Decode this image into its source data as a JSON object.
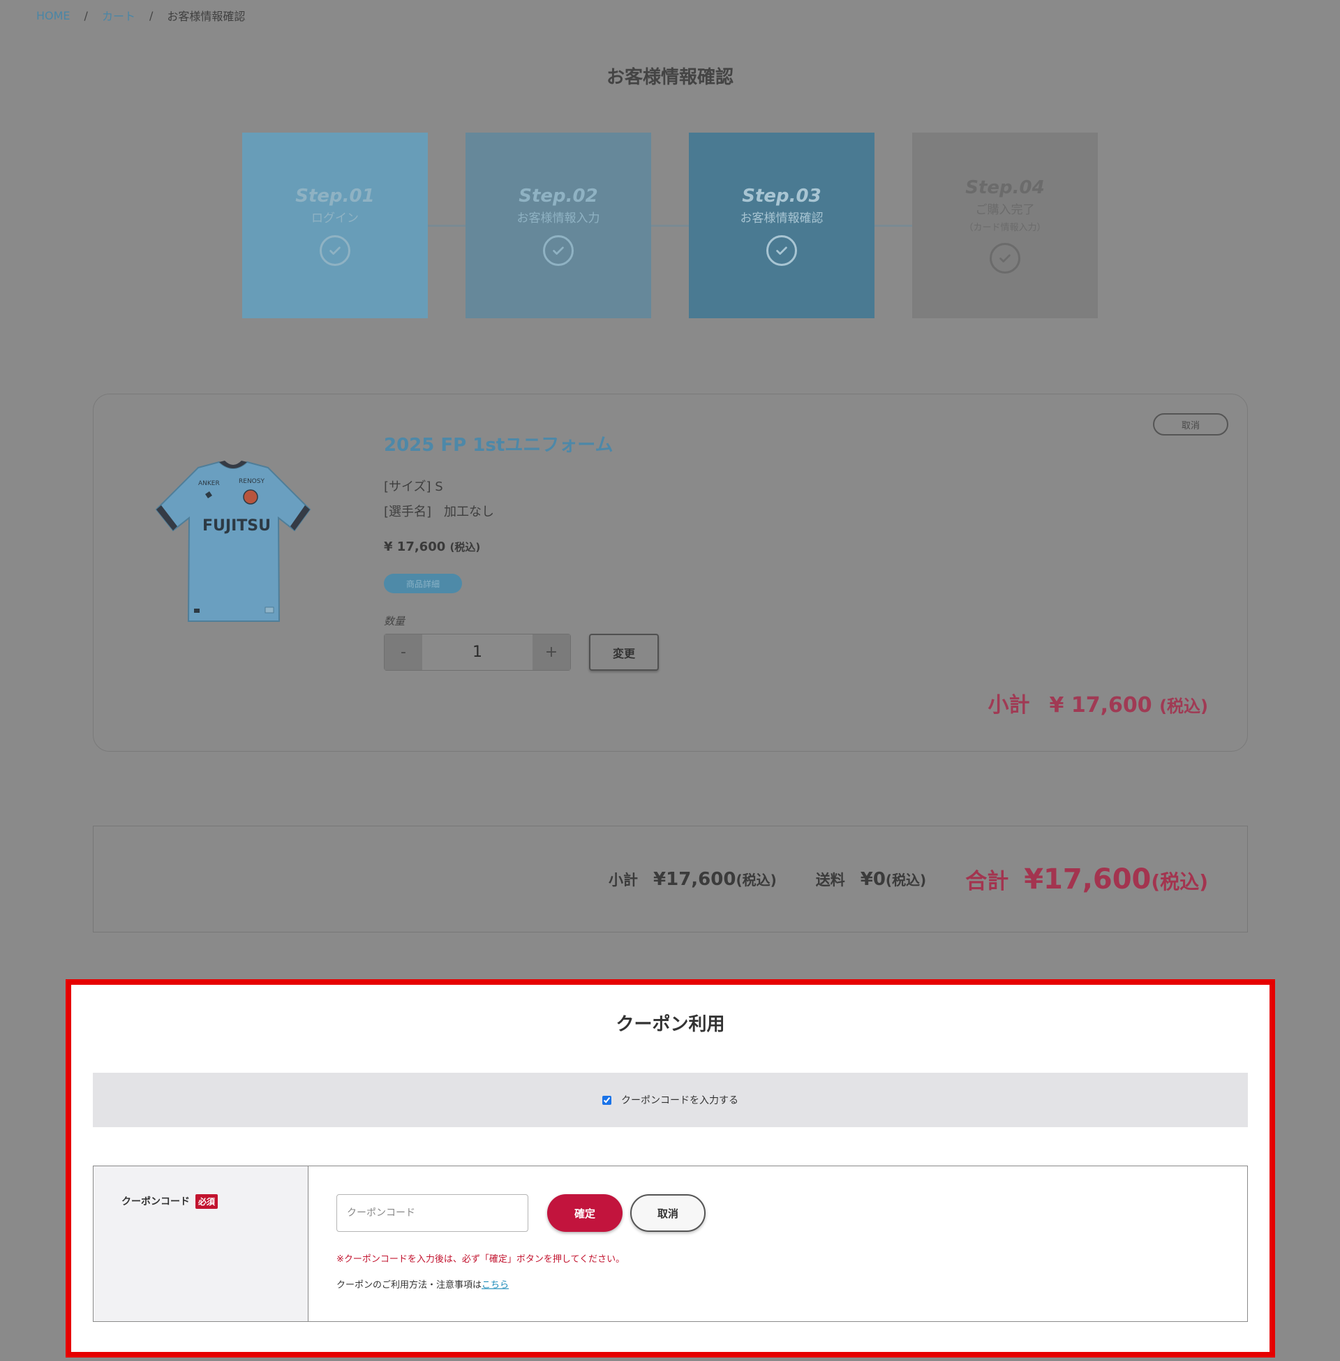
{
  "breadcrumb": {
    "home": "HOME",
    "sep": "/",
    "cart": "カート",
    "current": "お客様情報確認"
  },
  "page_title": "お客様情報確認",
  "steps": [
    {
      "num": "Step.01",
      "label": "ログイン",
      "sub": ""
    },
    {
      "num": "Step.02",
      "label": "お客様情報入力",
      "sub": ""
    },
    {
      "num": "Step.03",
      "label": "お客様情報確認",
      "sub": ""
    },
    {
      "num": "Step.04",
      "label": "ご購入完了",
      "sub": "（カード情報入力）"
    }
  ],
  "product": {
    "cancel_label": "取消",
    "title": "2025 FP 1stユニフォーム",
    "size": "[サイズ] S",
    "player": "[選手名]　加工なし",
    "price": "¥ 17,600",
    "price_tax": "(税込)",
    "detail_label": "商品詳細",
    "qty_label": "数量",
    "qty_minus": "-",
    "qty_value": "1",
    "qty_plus": "+",
    "change_label": "変更",
    "subtotal_label": "小計",
    "subtotal_value": "¥ 17,600",
    "subtotal_tax": "(税込)",
    "image_text": {
      "sponsor_left": "ANKER",
      "sponsor_right": "RENOSY",
      "chest": "FUJITSU"
    },
    "colors": {
      "shirt": "#6a9fc0",
      "trim": "#353b45"
    }
  },
  "totals": {
    "subtotal_label": "小計",
    "subtotal_value": "¥17,600",
    "subtotal_tax": "(税込)",
    "shipping_label": "送料",
    "shipping_value": "¥0",
    "shipping_tax": "(税込)",
    "grand_label": "合計",
    "grand_value": "¥17,600",
    "grand_tax": "(税込)"
  },
  "coupon": {
    "title": "クーポン利用",
    "toggle_label": "クーポンコードを入力する",
    "toggle_checked": true,
    "field_label": "クーポンコード",
    "required_badge": "必須",
    "input_placeholder": "クーポンコード",
    "input_value": "",
    "confirm_label": "確定",
    "cancel_label": "取消",
    "note": "※クーポンコードを入力後は、必ず「確定」ボタンを押してください。",
    "help_text": "クーポンのご利用方法・注意事項は",
    "help_link": "こちら"
  },
  "colors": {
    "overlay": "#8a8a8a",
    "highlight_border": "#e60000",
    "accent_red": "#c2143d",
    "accent_blue": "#4d88a8"
  }
}
